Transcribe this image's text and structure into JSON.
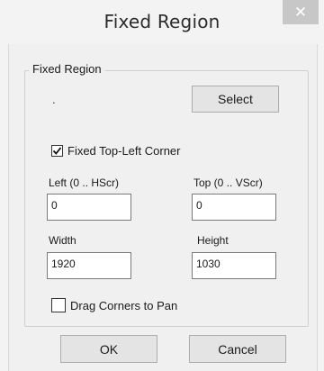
{
  "window": {
    "title": "Fixed Region",
    "close_glyph": "✕"
  },
  "group": {
    "legend": "Fixed Region",
    "dot": ".",
    "select_label": "Select"
  },
  "options": {
    "fixed_corner": {
      "label": "Fixed Top-Left Corner",
      "checked": true
    },
    "drag_corners": {
      "label": "Drag Corners to Pan",
      "checked": false
    }
  },
  "fields": {
    "left": {
      "label": "Left (0 .. HScr)",
      "value": "0"
    },
    "top": {
      "label": "Top (0 .. VScr)",
      "value": "0"
    },
    "width": {
      "label": "Width",
      "value": "1920"
    },
    "height": {
      "label": "Height",
      "value": "1030"
    }
  },
  "buttons": {
    "ok": "OK",
    "cancel": "Cancel"
  },
  "icons": {
    "close": "close-icon",
    "check": "checkmark-icon"
  }
}
